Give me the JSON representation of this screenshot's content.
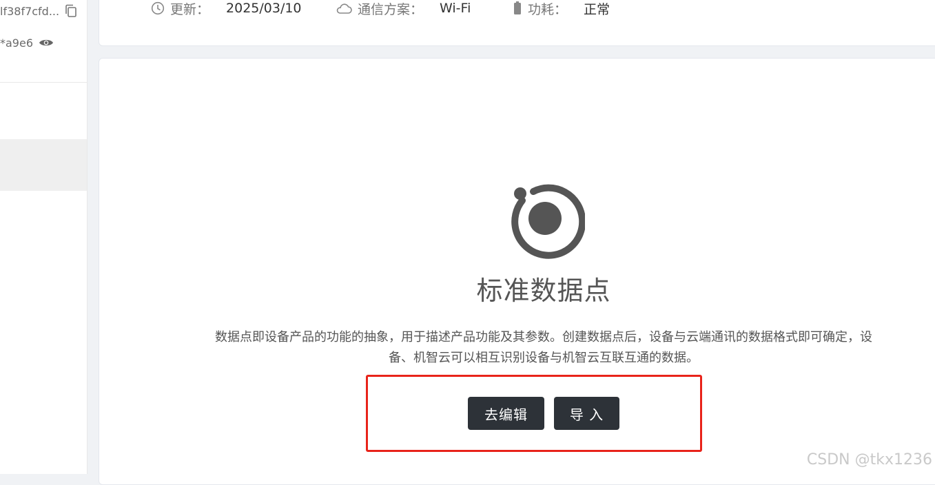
{
  "sidebar": {
    "product_key_value": "lf38f7cfd...",
    "product_secret_value": "*a9e6",
    "copy_icon": "copy-icon",
    "eye_icon": "eye-icon"
  },
  "info": {
    "updated_label": "更新：",
    "updated_value": "2025/03/10",
    "comm_label": "通信方案：",
    "comm_value": "Wi-Fi",
    "power_label": "功耗：",
    "power_value": "正常"
  },
  "main": {
    "title": "标准数据点",
    "description": "数据点即设备产品的功能的抽象，用于描述产品功能及其参数。创建数据点后，设备与云端通讯的数据格式即可确定，设备、机智云可以相互识别设备与机智云互联互通的数据。",
    "edit_button": "去编辑",
    "import_button": "导 入"
  },
  "watermark": "CSDN @tkx1236",
  "colors": {
    "button_bg": "#2d3238",
    "highlight": "#e8231a",
    "logo": "#555555"
  }
}
